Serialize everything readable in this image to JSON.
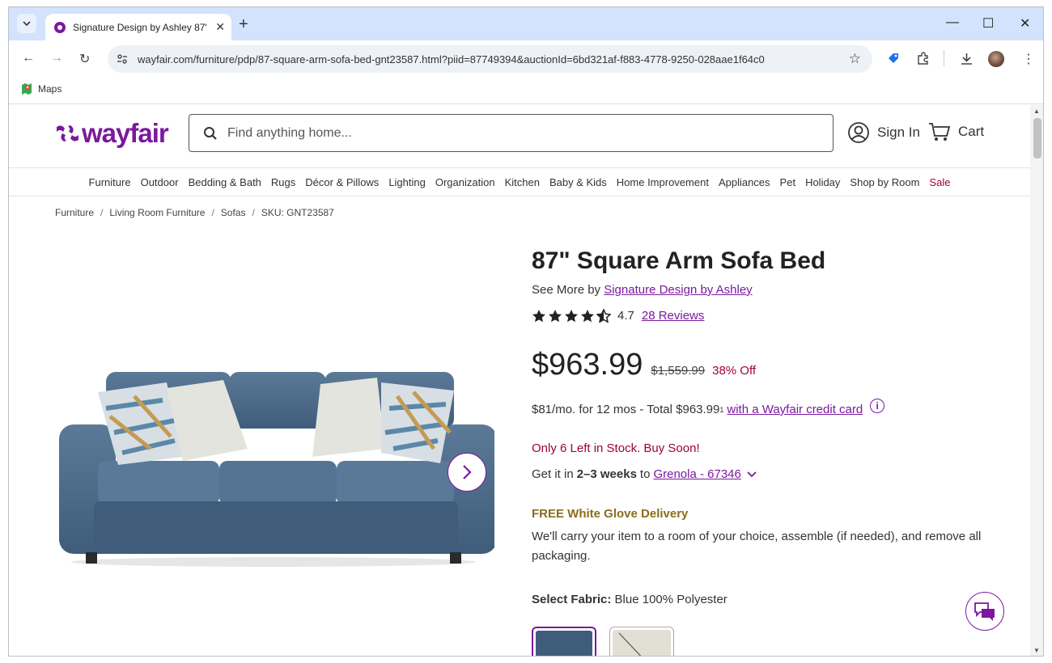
{
  "browser": {
    "tab_title": "Signature Design by Ashley 87\"",
    "url": "wayfair.com/furniture/pdp/87-square-arm-sofa-bed-gnt23587.html?piid=87749394&auctionId=6bd321af-f883-4778-9250-028aae1f64c0",
    "bookmarks": [
      {
        "label": "Maps"
      }
    ]
  },
  "header": {
    "logo_text": "wayfair",
    "search_placeholder": "Find anything home...",
    "sign_in": "Sign In",
    "cart": "Cart"
  },
  "categories": [
    "Furniture",
    "Outdoor",
    "Bedding & Bath",
    "Rugs",
    "Décor & Pillows",
    "Lighting",
    "Organization",
    "Kitchen",
    "Baby & Kids",
    "Home Improvement",
    "Appliances",
    "Pet",
    "Holiday",
    "Shop by Room",
    "Sale"
  ],
  "breadcrumb": [
    "Furniture",
    "Living Room Furniture",
    "Sofas",
    "SKU: GNT23587"
  ],
  "product": {
    "title": "87\" Square Arm Sofa Bed",
    "see_more_prefix": "See More by",
    "brand": "Signature Design by Ashley",
    "rating": "4.7",
    "stars": 4.5,
    "reviews": "28 Reviews",
    "price": "$963.99",
    "original_price": "$1,559.99",
    "discount": "38% Off",
    "finance_text": "$81/mo. for 12 mos - Total $963.99",
    "finance_sup": "1",
    "finance_link": "with a Wayfair credit card",
    "stock": "Only 6 Left in Stock. Buy Soon!",
    "delivery_prefix": "Get it in",
    "delivery_time": "2–3 weeks",
    "delivery_to": "to",
    "delivery_location": "Grenola - 67346",
    "free_delivery_title": "FREE White Glove Delivery",
    "free_delivery_desc": "We'll carry your item to a room of your choice, assemble (if needed), and remove all packaging.",
    "fabric_label": "Select Fabric:",
    "fabric_value": "Blue 100% Polyester"
  },
  "colors": {
    "brand": "#7b189f",
    "sale": "#a0003c",
    "gold": "#8a6d1b",
    "sofa": "#4f6e8c"
  }
}
